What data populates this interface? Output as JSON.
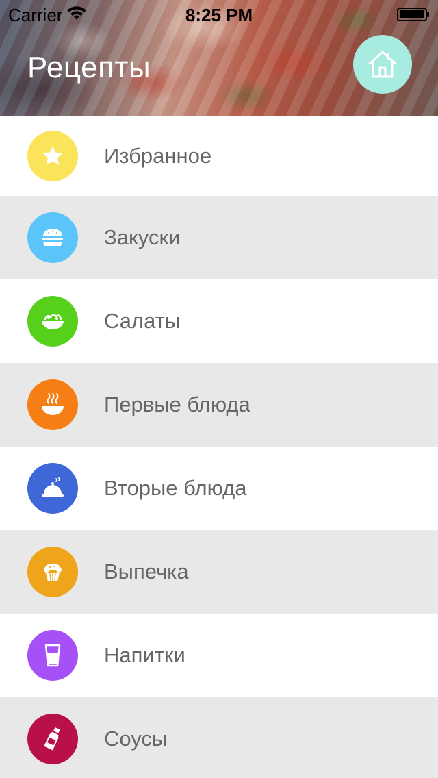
{
  "status_bar": {
    "carrier": "Carrier",
    "time": "8:25 PM",
    "wifi_icon": "wifi-icon",
    "battery_icon": "battery-icon"
  },
  "header": {
    "title": "Рецепты",
    "home_button_icon": "home-icon",
    "home_button_color": "#a8ebe0"
  },
  "categories": [
    {
      "label": "Избранное",
      "icon": "star-icon",
      "color": "#fbe35a"
    },
    {
      "label": "Закуски",
      "icon": "burger-icon",
      "color": "#5bc4f8"
    },
    {
      "label": "Салаты",
      "icon": "salad-bowl-icon",
      "color": "#56d01a"
    },
    {
      "label": "Первые блюда",
      "icon": "soup-bowl-icon",
      "color": "#f57f14"
    },
    {
      "label": "Вторые блюда",
      "icon": "cloche-icon",
      "color": "#3e67d8"
    },
    {
      "label": "Выпечка",
      "icon": "muffin-icon",
      "color": "#eea51c"
    },
    {
      "label": "Напитки",
      "icon": "glass-icon",
      "color": "#a650f8"
    },
    {
      "label": "Соусы",
      "icon": "sauce-bottle-icon",
      "color": "#b91047"
    }
  ],
  "colors": {
    "alt_row_background": "#e8e8e8",
    "label_text": "#666666"
  }
}
